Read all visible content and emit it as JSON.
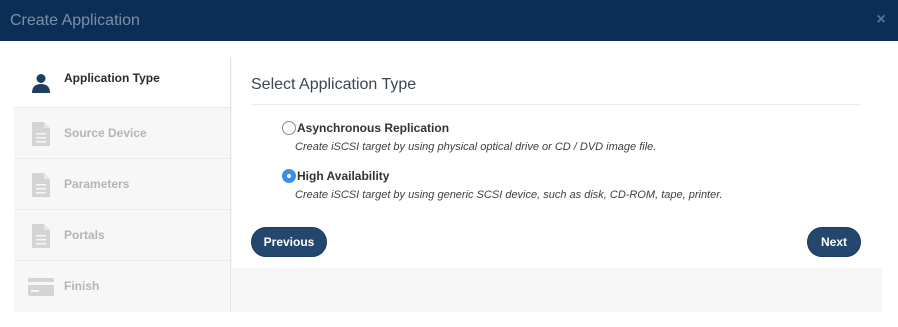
{
  "window": {
    "title": "Create Application",
    "close_icon": "×"
  },
  "steps": [
    {
      "label": "Application Type",
      "icon": "user-icon",
      "active": true
    },
    {
      "label": "Source Device",
      "icon": "document-icon",
      "active": false
    },
    {
      "label": "Parameters",
      "icon": "document-icon",
      "active": false
    },
    {
      "label": "Portals",
      "icon": "document-icon",
      "active": false
    },
    {
      "label": "Finish",
      "icon": "credit-card-icon",
      "active": false
    }
  ],
  "content": {
    "title": "Select Application Type",
    "options": [
      {
        "label": "Asynchronous Replication",
        "description": "Create iSCSI target by using physical optical drive or CD / DVD image file.",
        "selected": false
      },
      {
        "label": "High Availability",
        "description": "Create iSCSI target by using generic SCSI device, such as disk, CD-ROM, tape, printer.",
        "selected": true
      }
    ]
  },
  "buttons": {
    "previous": "Previous",
    "next": "Next"
  },
  "colors": {
    "titlebar": "#0b2e57",
    "button": "#23476d",
    "radio_selected": "#3a8ee6",
    "step_active_icon": "#1f3d5f",
    "step_inactive_icon": "#d4d4d4"
  }
}
